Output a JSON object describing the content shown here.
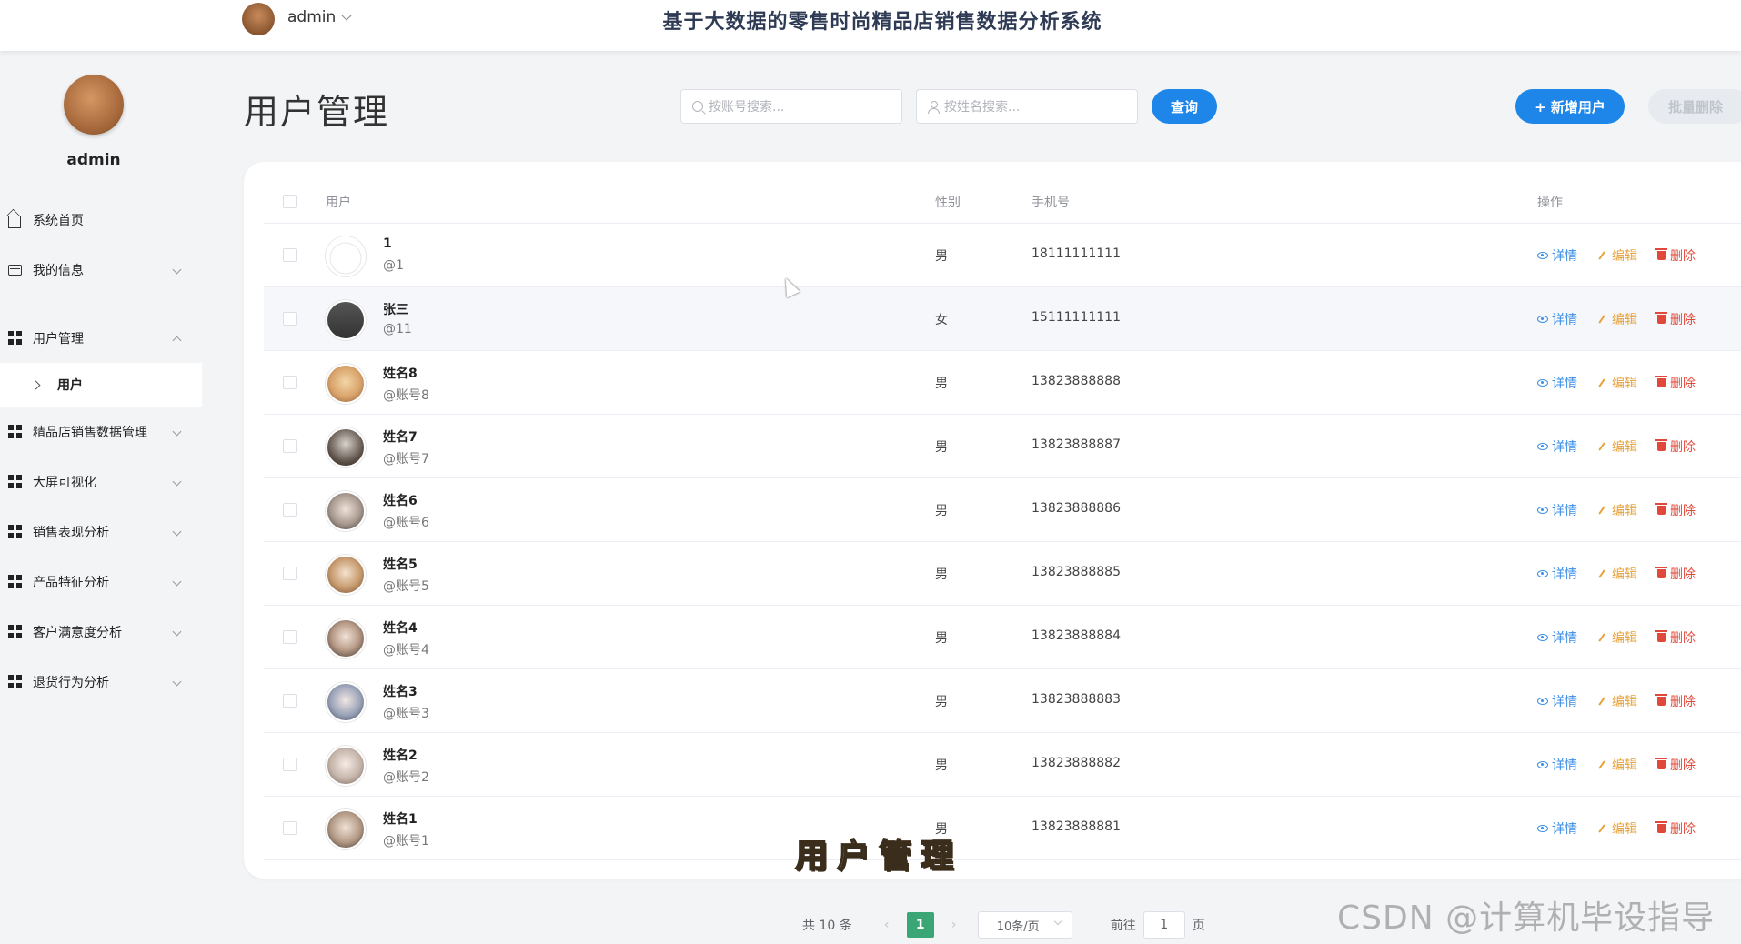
{
  "header": {
    "username": "admin",
    "system_title": "基于大数据的零售时尚精品店销售数据分析系统"
  },
  "sidebar": {
    "username": "admin",
    "items": [
      {
        "label": "系统首页",
        "icon": "home-icon"
      },
      {
        "label": "我的信息",
        "icon": "id-card-icon"
      },
      {
        "label": "用户管理",
        "icon": "grid-icon",
        "expanded": true
      },
      {
        "label": "精品店销售数据管理",
        "icon": "grid-icon"
      },
      {
        "label": "大屏可视化",
        "icon": "grid-icon"
      },
      {
        "label": "销售表现分析",
        "icon": "grid-icon"
      },
      {
        "label": "产品特征分析",
        "icon": "grid-icon"
      },
      {
        "label": "客户满意度分析",
        "icon": "grid-icon"
      },
      {
        "label": "退货行为分析",
        "icon": "grid-icon"
      }
    ],
    "submenu_user": "用户"
  },
  "page": {
    "title": "用户管理",
    "search_account_placeholder": "按账号搜索...",
    "search_name_placeholder": "按姓名搜索...",
    "query_button": "查询",
    "add_button": "+ 新增用户",
    "batch_delete_button": "批量删除"
  },
  "table": {
    "headers": {
      "user": "用户",
      "gender": "性别",
      "phone": "手机号",
      "actions": "操作"
    },
    "action_labels": {
      "view": "详情",
      "edit": "编辑",
      "delete": "删除"
    },
    "rows": [
      {
        "name": "1",
        "account": "@1",
        "gender": "男",
        "phone": "18111111111"
      },
      {
        "name": "张三",
        "account": "@11",
        "gender": "女",
        "phone": "15111111111"
      },
      {
        "name": "姓名8",
        "account": "@账号8",
        "gender": "男",
        "phone": "13823888888"
      },
      {
        "name": "姓名7",
        "account": "@账号7",
        "gender": "男",
        "phone": "13823888887"
      },
      {
        "name": "姓名6",
        "account": "@账号6",
        "gender": "男",
        "phone": "13823888886"
      },
      {
        "name": "姓名5",
        "account": "@账号5",
        "gender": "男",
        "phone": "13823888885"
      },
      {
        "name": "姓名4",
        "account": "@账号4",
        "gender": "男",
        "phone": "13823888884"
      },
      {
        "name": "姓名3",
        "account": "@账号3",
        "gender": "男",
        "phone": "13823888883"
      },
      {
        "name": "姓名2",
        "account": "@账号2",
        "gender": "男",
        "phone": "13823888882"
      },
      {
        "name": "姓名1",
        "account": "@账号1",
        "gender": "男",
        "phone": "13823888881"
      }
    ]
  },
  "pagination": {
    "total_text": "共 10 条",
    "current_page": "1",
    "page_size": "10条/页",
    "goto_label": "前往",
    "goto_value": "1",
    "page_suffix": "页"
  },
  "overlay": {
    "caption": "用户管理",
    "watermark": "CSDN @计算机毕设指导师"
  }
}
